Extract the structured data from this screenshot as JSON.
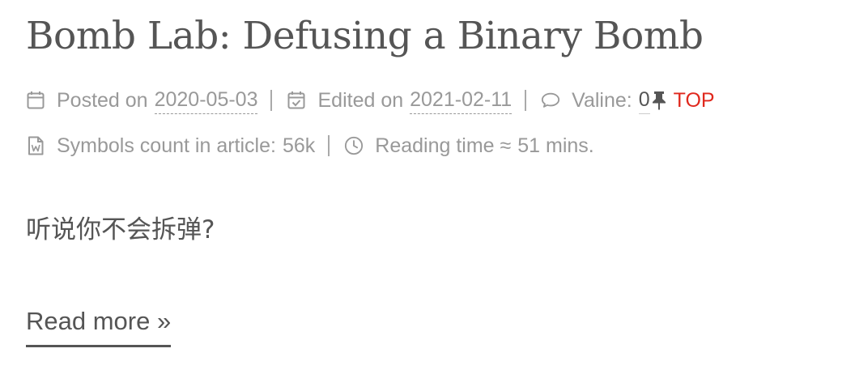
{
  "post": {
    "title": "Bomb Lab: Defusing a Binary Bomb",
    "meta": {
      "posted_label": "Posted on",
      "posted_date": "2020-05-03",
      "edited_label": "Edited on",
      "edited_date": "2021-02-11",
      "comments_label": "Valine:",
      "comments_count": "0",
      "top_label": "TOP",
      "symbols_label": "Symbols count in article:",
      "symbols_value": "56k",
      "reading_label": "Reading time ≈",
      "reading_value": "51 mins."
    },
    "excerpt": "听说你不会拆弹?",
    "read_more": "Read more »"
  },
  "icons": {
    "posted": "calendar-icon",
    "edited": "calendar-check-icon",
    "comments": "comment-icon",
    "pin": "thumbtack-icon",
    "symbols": "file-word-icon",
    "reading": "clock-icon"
  },
  "colors": {
    "text": "#555555",
    "meta": "#999999",
    "top": "#e0281d"
  }
}
